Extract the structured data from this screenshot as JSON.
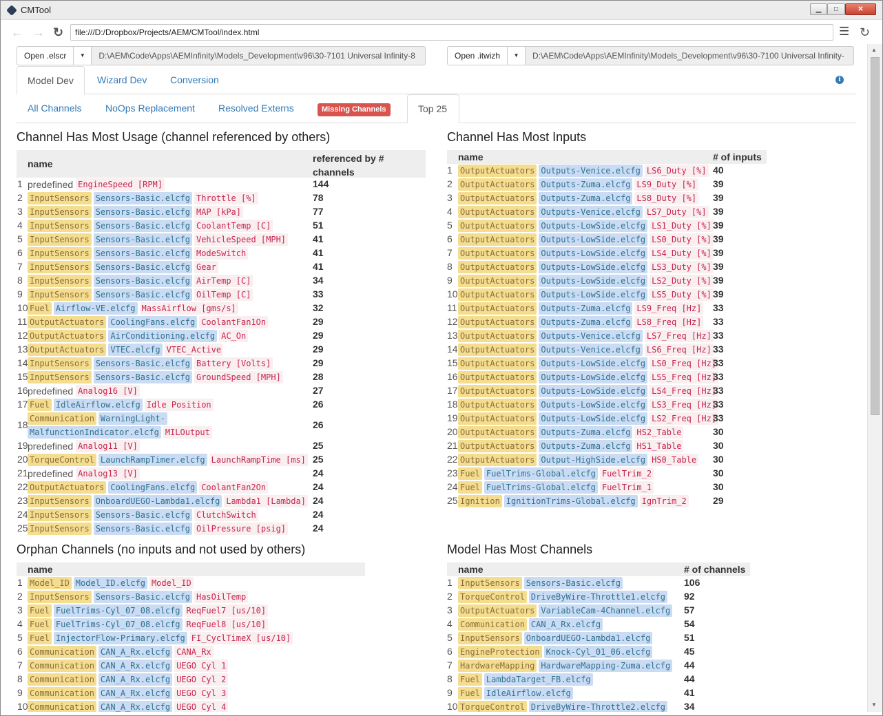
{
  "window": {
    "title": "CMTool",
    "min_label": "▁",
    "max_label": "□",
    "close_label": "✕"
  },
  "nav": {
    "url": "file:///D:/Dropbox/Projects/AEM/CMTool/index.html"
  },
  "files": {
    "left": {
      "button": "Open .elscr",
      "path": "D:\\AEM\\Code\\Apps\\AEMInfinity\\Models_Development\\v96\\30-7101 Universal Infinity-8"
    },
    "right": {
      "button": "Open .itwizh",
      "path": "D:\\AEM\\Code\\Apps\\AEMInfinity\\Models_Development\\v96\\30-7100 Universal Infinity-"
    }
  },
  "tabs_main": [
    "Model Dev",
    "Wizard Dev",
    "Conversion"
  ],
  "tabs_sub": [
    "All Channels",
    "NoOps Replacement",
    "Resolved Externs",
    "Missing Channels",
    "Top 25"
  ],
  "colors": {
    "link": "#337ab7",
    "badge": "#d9534f",
    "category": "#f5dd8f",
    "file": "#c9dcf4",
    "channel": "#c7254e"
  },
  "usage": {
    "title": "Channel Has Most Usage (channel referenced by others)",
    "col_name": "name",
    "col_value": "referenced by # channels",
    "rows": [
      {
        "i": "1",
        "cat": "",
        "pre": "predefined",
        "file": "",
        "ch": "EngineSpeed [RPM]",
        "v": "144"
      },
      {
        "i": "2",
        "cat": "InputSensors",
        "file": "Sensors-Basic.elcfg",
        "ch": "Throttle [%]",
        "v": "78"
      },
      {
        "i": "3",
        "cat": "InputSensors",
        "file": "Sensors-Basic.elcfg",
        "ch": "MAP [kPa]",
        "v": "77"
      },
      {
        "i": "4",
        "cat": "InputSensors",
        "file": "Sensors-Basic.elcfg",
        "ch": "CoolantTemp [C]",
        "v": "51"
      },
      {
        "i": "5",
        "cat": "InputSensors",
        "file": "Sensors-Basic.elcfg",
        "ch": "VehicleSpeed [MPH]",
        "v": "41"
      },
      {
        "i": "6",
        "cat": "InputSensors",
        "file": "Sensors-Basic.elcfg",
        "ch": "ModeSwitch",
        "v": "41"
      },
      {
        "i": "7",
        "cat": "InputSensors",
        "file": "Sensors-Basic.elcfg",
        "ch": "Gear",
        "v": "41"
      },
      {
        "i": "8",
        "cat": "InputSensors",
        "file": "Sensors-Basic.elcfg",
        "ch": "AirTemp [C]",
        "v": "34"
      },
      {
        "i": "9",
        "cat": "InputSensors",
        "file": "Sensors-Basic.elcfg",
        "ch": "OilTemp [C]",
        "v": "33"
      },
      {
        "i": "10",
        "cat": "Fuel",
        "file": "Airflow-VE.elcfg",
        "ch": "MassAirflow [gms/s]",
        "v": "32"
      },
      {
        "i": "11",
        "cat": "OutputActuators",
        "file": "CoolingFans.elcfg",
        "ch": "CoolantFan1On",
        "v": "29"
      },
      {
        "i": "12",
        "cat": "OutputActuators",
        "file": "AirConditioning.elcfg",
        "ch": "AC_On",
        "v": "29"
      },
      {
        "i": "13",
        "cat": "OutputActuators",
        "file": "VTEC.elcfg",
        "ch": "VTEC_Active",
        "v": "29"
      },
      {
        "i": "14",
        "cat": "InputSensors",
        "file": "Sensors-Basic.elcfg",
        "ch": "Battery [Volts]",
        "v": "29"
      },
      {
        "i": "15",
        "cat": "InputSensors",
        "file": "Sensors-Basic.elcfg",
        "ch": "GroundSpeed [MPH]",
        "v": "28"
      },
      {
        "i": "16",
        "cat": "",
        "pre": "predefined",
        "file": "",
        "ch": "Analog16 [V]",
        "v": "27"
      },
      {
        "i": "17",
        "cat": "Fuel",
        "file": "IdleAirflow.elcfg",
        "ch": "Idle Position",
        "v": "26"
      },
      {
        "i": "18",
        "cat": "Communication",
        "file": "WarningLight-",
        "file2": "MalfunctionIndicator.elcfg",
        "ch": "MILOutput",
        "v": "26"
      },
      {
        "i": "19",
        "cat": "",
        "pre": "predefined",
        "file": "",
        "ch": "Analog11 [V]",
        "v": "25"
      },
      {
        "i": "20",
        "cat": "TorqueControl",
        "file": "LaunchRampTimer.elcfg",
        "ch": "LaunchRampTime [ms]",
        "v": "25"
      },
      {
        "i": "21",
        "cat": "",
        "pre": "predefined",
        "file": "",
        "ch": "Analog13 [V]",
        "v": "24"
      },
      {
        "i": "22",
        "cat": "OutputActuators",
        "file": "CoolingFans.elcfg",
        "ch": "CoolantFan2On",
        "v": "24"
      },
      {
        "i": "23",
        "cat": "InputSensors",
        "file": "OnboardUEGO-Lambda1.elcfg",
        "ch": "Lambda1 [Lambda]",
        "v": "24"
      },
      {
        "i": "24",
        "cat": "InputSensors",
        "file": "Sensors-Basic.elcfg",
        "ch": "ClutchSwitch",
        "v": "24"
      },
      {
        "i": "25",
        "cat": "InputSensors",
        "file": "Sensors-Basic.elcfg",
        "ch": "OilPressure [psig]",
        "v": "24"
      }
    ]
  },
  "inputs": {
    "title": "Channel Has Most Inputs",
    "col_name": "name",
    "col_value": "# of inputs",
    "rows": [
      {
        "i": "1",
        "cat": "OutputActuators",
        "file": "Outputs-Venice.elcfg",
        "ch": "LS6_Duty [%]",
        "v": "40"
      },
      {
        "i": "2",
        "cat": "OutputActuators",
        "file": "Outputs-Zuma.elcfg",
        "ch": "LS9_Duty [%]",
        "v": "39"
      },
      {
        "i": "3",
        "cat": "OutputActuators",
        "file": "Outputs-Zuma.elcfg",
        "ch": "LS8_Duty [%]",
        "v": "39"
      },
      {
        "i": "4",
        "cat": "OutputActuators",
        "file": "Outputs-Venice.elcfg",
        "ch": "LS7_Duty [%]",
        "v": "39"
      },
      {
        "i": "5",
        "cat": "OutputActuators",
        "file": "Outputs-LowSide.elcfg",
        "ch": "LS1_Duty [%]",
        "v": "39"
      },
      {
        "i": "6",
        "cat": "OutputActuators",
        "file": "Outputs-LowSide.elcfg",
        "ch": "LS0_Duty [%]",
        "v": "39"
      },
      {
        "i": "7",
        "cat": "OutputActuators",
        "file": "Outputs-LowSide.elcfg",
        "ch": "LS4_Duty [%]",
        "v": "39"
      },
      {
        "i": "8",
        "cat": "OutputActuators",
        "file": "Outputs-LowSide.elcfg",
        "ch": "LS3_Duty [%]",
        "v": "39"
      },
      {
        "i": "9",
        "cat": "OutputActuators",
        "file": "Outputs-LowSide.elcfg",
        "ch": "LS2_Duty [%]",
        "v": "39"
      },
      {
        "i": "10",
        "cat": "OutputActuators",
        "file": "Outputs-LowSide.elcfg",
        "ch": "LS5_Duty [%]",
        "v": "39"
      },
      {
        "i": "11",
        "cat": "OutputActuators",
        "file": "Outputs-Zuma.elcfg",
        "ch": "LS9_Freq [Hz]",
        "v": "33"
      },
      {
        "i": "12",
        "cat": "OutputActuators",
        "file": "Outputs-Zuma.elcfg",
        "ch": "LS8_Freq [Hz]",
        "v": "33"
      },
      {
        "i": "13",
        "cat": "OutputActuators",
        "file": "Outputs-Venice.elcfg",
        "ch": "LS7_Freq [Hz]",
        "v": "33"
      },
      {
        "i": "14",
        "cat": "OutputActuators",
        "file": "Outputs-Venice.elcfg",
        "ch": "LS6_Freq [Hz]",
        "v": "33"
      },
      {
        "i": "15",
        "cat": "OutputActuators",
        "file": "Outputs-LowSide.elcfg",
        "ch": "LS0_Freq [Hz]",
        "v": "33"
      },
      {
        "i": "16",
        "cat": "OutputActuators",
        "file": "Outputs-LowSide.elcfg",
        "ch": "LS5_Freq [Hz]",
        "v": "33"
      },
      {
        "i": "17",
        "cat": "OutputActuators",
        "file": "Outputs-LowSide.elcfg",
        "ch": "LS4_Freq [Hz]",
        "v": "33"
      },
      {
        "i": "18",
        "cat": "OutputActuators",
        "file": "Outputs-LowSide.elcfg",
        "ch": "LS3_Freq [Hz]",
        "v": "33"
      },
      {
        "i": "19",
        "cat": "OutputActuators",
        "file": "Outputs-LowSide.elcfg",
        "ch": "LS2_Freq [Hz]",
        "v": "33"
      },
      {
        "i": "20",
        "cat": "OutputActuators",
        "file": "Outputs-Zuma.elcfg",
        "ch": "HS2_Table",
        "v": "30"
      },
      {
        "i": "21",
        "cat": "OutputActuators",
        "file": "Outputs-Zuma.elcfg",
        "ch": "HS1_Table",
        "v": "30"
      },
      {
        "i": "22",
        "cat": "OutputActuators",
        "file": "Output-HighSide.elcfg",
        "ch": "HS0_Table",
        "v": "30"
      },
      {
        "i": "23",
        "cat": "Fuel",
        "file": "FuelTrims-Global.elcfg",
        "ch": "FuelTrim_2",
        "v": "30"
      },
      {
        "i": "24",
        "cat": "Fuel",
        "file": "FuelTrims-Global.elcfg",
        "ch": "FuelTrim_1",
        "v": "30"
      },
      {
        "i": "25",
        "cat": "Ignition",
        "file": "IgnitionTrims-Global.elcfg",
        "ch": "IgnTrim_2",
        "v": "29"
      }
    ]
  },
  "orphans": {
    "title": "Orphan Channels (no inputs and not used by others)",
    "col_name": "name",
    "rows": [
      {
        "i": "1",
        "cat": "Model_ID",
        "file": "Model_ID.elcfg",
        "ch": "Model_ID"
      },
      {
        "i": "2",
        "cat": "InputSensors",
        "file": "Sensors-Basic.elcfg",
        "ch": "HasOilTemp"
      },
      {
        "i": "3",
        "cat": "Fuel",
        "file": "FuelTrims-Cyl_07_08.elcfg",
        "ch": "ReqFuel7 [us/10]"
      },
      {
        "i": "4",
        "cat": "Fuel",
        "file": "FuelTrims-Cyl_07_08.elcfg",
        "ch": "ReqFuel8 [us/10]"
      },
      {
        "i": "5",
        "cat": "Fuel",
        "file": "InjectorFlow-Primary.elcfg",
        "ch": "FI_CyclTimeX [us/10]"
      },
      {
        "i": "6",
        "cat": "Communication",
        "file": "CAN_A_Rx.elcfg",
        "ch": "CANA_Rx"
      },
      {
        "i": "7",
        "cat": "Communication",
        "file": "CAN_A_Rx.elcfg",
        "ch": "UEGO Cyl 1"
      },
      {
        "i": "8",
        "cat": "Communication",
        "file": "CAN_A_Rx.elcfg",
        "ch": "UEGO Cyl 2"
      },
      {
        "i": "9",
        "cat": "Communication",
        "file": "CAN_A_Rx.elcfg",
        "ch": "UEGO Cyl 3"
      },
      {
        "i": "10",
        "cat": "Communication",
        "file": "CAN_A_Rx.elcfg",
        "ch": "UEGO Cyl 4"
      }
    ]
  },
  "models": {
    "title": "Model Has Most Channels",
    "col_name": "name",
    "col_value": "# of channels",
    "rows": [
      {
        "i": "1",
        "cat": "InputSensors",
        "file": "Sensors-Basic.elcfg",
        "v": "106"
      },
      {
        "i": "2",
        "cat": "TorqueControl",
        "file": "DriveByWire-Throttle1.elcfg",
        "v": "92"
      },
      {
        "i": "3",
        "cat": "OutputActuators",
        "file": "VariableCam-4Channel.elcfg",
        "v": "57"
      },
      {
        "i": "4",
        "cat": "Communication",
        "file": "CAN_A_Rx.elcfg",
        "v": "54"
      },
      {
        "i": "5",
        "cat": "InputSensors",
        "file": "OnboardUEGO-Lambda1.elcfg",
        "v": "51"
      },
      {
        "i": "6",
        "cat": "EngineProtection",
        "file": "Knock-Cyl_01_06.elcfg",
        "v": "45"
      },
      {
        "i": "7",
        "cat": "HardwareMapping",
        "file": "HardwareMapping-Zuma.elcfg",
        "v": "44"
      },
      {
        "i": "8",
        "cat": "Fuel",
        "file": "LambdaTarget_FB.elcfg",
        "v": "44"
      },
      {
        "i": "9",
        "cat": "Fuel",
        "file": "IdleAirflow.elcfg",
        "v": "41"
      },
      {
        "i": "10",
        "cat": "TorqueControl",
        "file": "DriveByWire-Throttle2.elcfg",
        "v": "34"
      }
    ]
  }
}
